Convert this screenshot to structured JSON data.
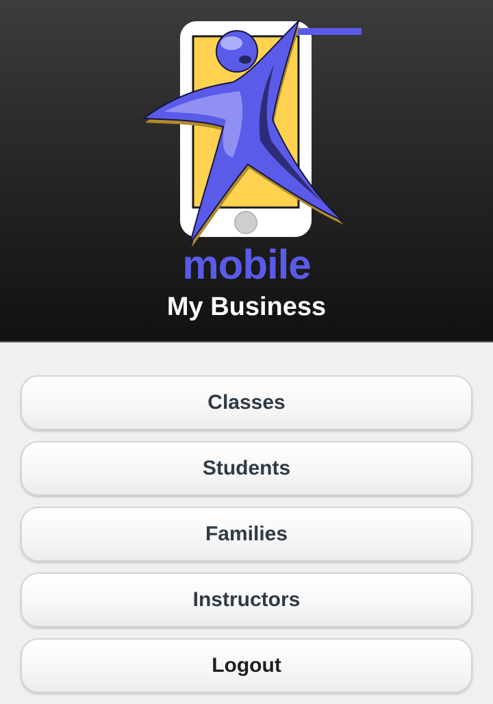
{
  "header": {
    "brand": "mobile",
    "title": "My Business",
    "logo_icon": "dancer-phone-logo-icon"
  },
  "colors": {
    "brand_purple": "#5b5bea",
    "phone_yellow": "#ffd24f",
    "header_dark": "#1f1f1f",
    "button_text": "#2f3b45"
  },
  "menu": {
    "items": [
      {
        "label": "Classes"
      },
      {
        "label": "Students"
      },
      {
        "label": "Families"
      },
      {
        "label": "Instructors"
      },
      {
        "label": "Logout"
      }
    ]
  }
}
